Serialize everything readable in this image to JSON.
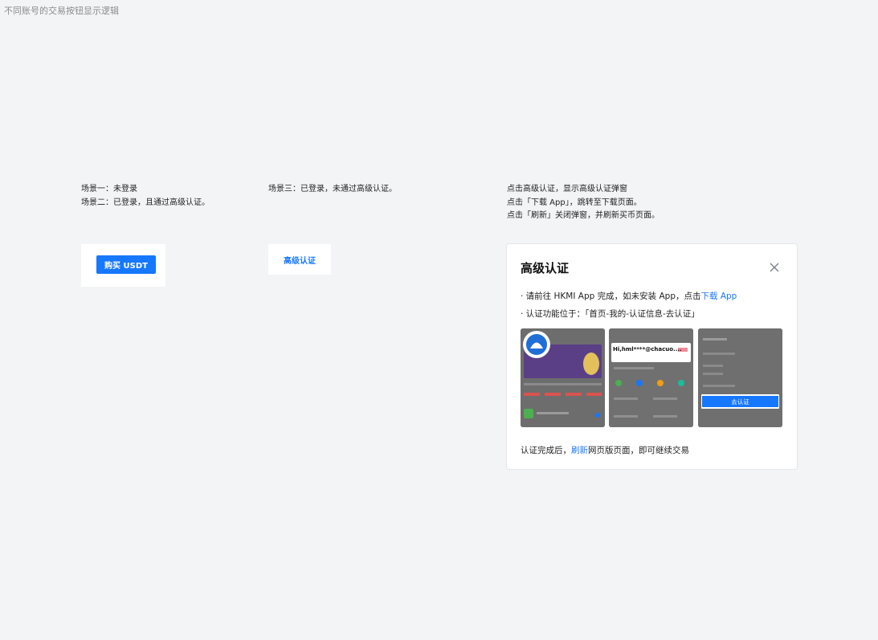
{
  "page": {
    "title": "不同账号的交易按钮显示逻辑"
  },
  "scenarios": {
    "col1_line1": "场景一：未登录",
    "col1_line2": "场景二：已登录，且通过高级认证。",
    "col2_line1": "场景三：已登录，未通过高级认证。",
    "col3_line1": "点击高级认证，显示高级认证弹窗",
    "col3_line2": "点击「下载 App」，跳转至下载页面。",
    "col3_line3": "点击「刷新」关闭弹窗，并刷新买币页面。"
  },
  "buttons": {
    "buy_usdt": "购买 USDT",
    "advanced_auth": "高级认证"
  },
  "modal": {
    "title": "高级认证",
    "line1_prefix": "· 请前往 HKMI App 完成，如未安装 App，点击",
    "line1_link": "下载 App",
    "line2": "· 认证功能位于：「首页-我的-认证信息-去认证」",
    "shot2_label": "Hi,hml****@chacuo....",
    "shot3_button": "去认证",
    "footer_prefix": "认证完成后，",
    "footer_link": "刷新",
    "footer_suffix": "网页版页面，即可继续交易"
  },
  "colors": {
    "accent": "#1677ff",
    "background": "#f2f4f6"
  }
}
